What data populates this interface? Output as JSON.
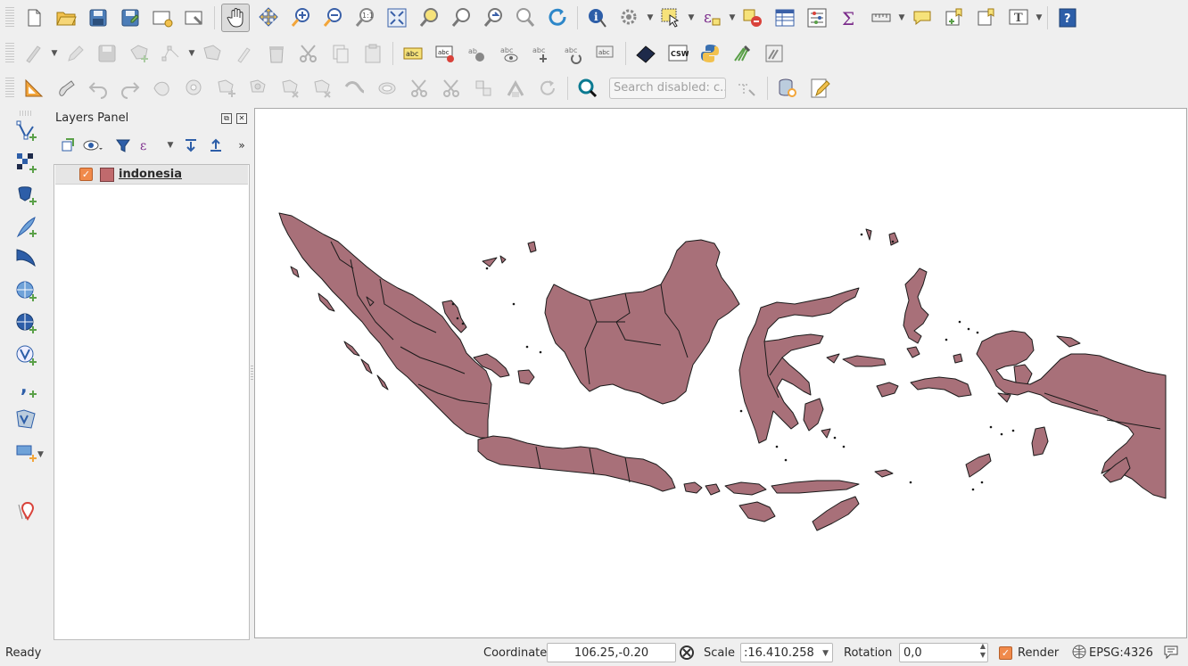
{
  "toolbars": {
    "row1": [
      "new-project",
      "open-project",
      "save-project",
      "save-as",
      "new-print-layout",
      "layout-manager",
      "pan-map",
      "pan-to-selection",
      "zoom-in",
      "zoom-out",
      "zoom-native",
      "zoom-full",
      "zoom-to-selection",
      "zoom-to-layer",
      "zoom-last",
      "zoom-next",
      "refresh",
      "identify",
      "actions",
      "select-features",
      "expression-select",
      "deselect",
      "attribute-table",
      "statistics",
      "field-calculator",
      "measure",
      "map-tips",
      "new-bookmark",
      "show-bookmarks",
      "text-annotation",
      "help"
    ],
    "row2": [
      "digitize",
      "edit-pencil",
      "save-edits",
      "add-polygon",
      "vertex-tool",
      "modify-attributes",
      "delete-selected",
      "cut-features",
      "copy-features",
      "paste-features",
      "label-tool",
      "pin-labels",
      "highlight-labels",
      "show-hide-labels",
      "move-label",
      "rotate-label",
      "change-label",
      "metasearch",
      "csw",
      "python-console",
      "grass-tools",
      "grass-tools-2"
    ],
    "row3": [
      "snapping-tool",
      "enable-tracing",
      "undo",
      "redo",
      "simplify",
      "add-ring",
      "add-part",
      "fill-ring",
      "delete-ring",
      "delete-part",
      "reshape",
      "offset-curve",
      "split-features",
      "split-parts",
      "merge",
      "merge-attributes",
      "rotate-symbols",
      "locator"
    ],
    "search_placeholder": "Search disabled: c..."
  },
  "left_toolbar": [
    "add-vector-layer",
    "add-raster-layer",
    "add-postgis-layer",
    "add-spatialite-layer",
    "add-mssql-layer",
    "add-wms-layer",
    "add-wcs-layer",
    "add-wfs-layer",
    "add-delimited-text",
    "add-virtual-layer",
    "new-layer",
    "georeferencer"
  ],
  "layers_panel": {
    "title": "Layers Panel",
    "layers": [
      {
        "name": "indonesia",
        "visible": true,
        "color": "#c06a6d"
      }
    ]
  },
  "map": {
    "fill": "#a87079",
    "stroke": "#1a1a1a"
  },
  "status": {
    "message": "Ready",
    "coordinate_label": "Coordinate",
    "coordinate_value": "106.25,-0.20",
    "scale_label": "Scale",
    "scale_value": ":16.410.258",
    "rotation_label": "Rotation",
    "rotation_value": "0,0",
    "render_label": "Render",
    "crs": "EPSG:4326"
  }
}
